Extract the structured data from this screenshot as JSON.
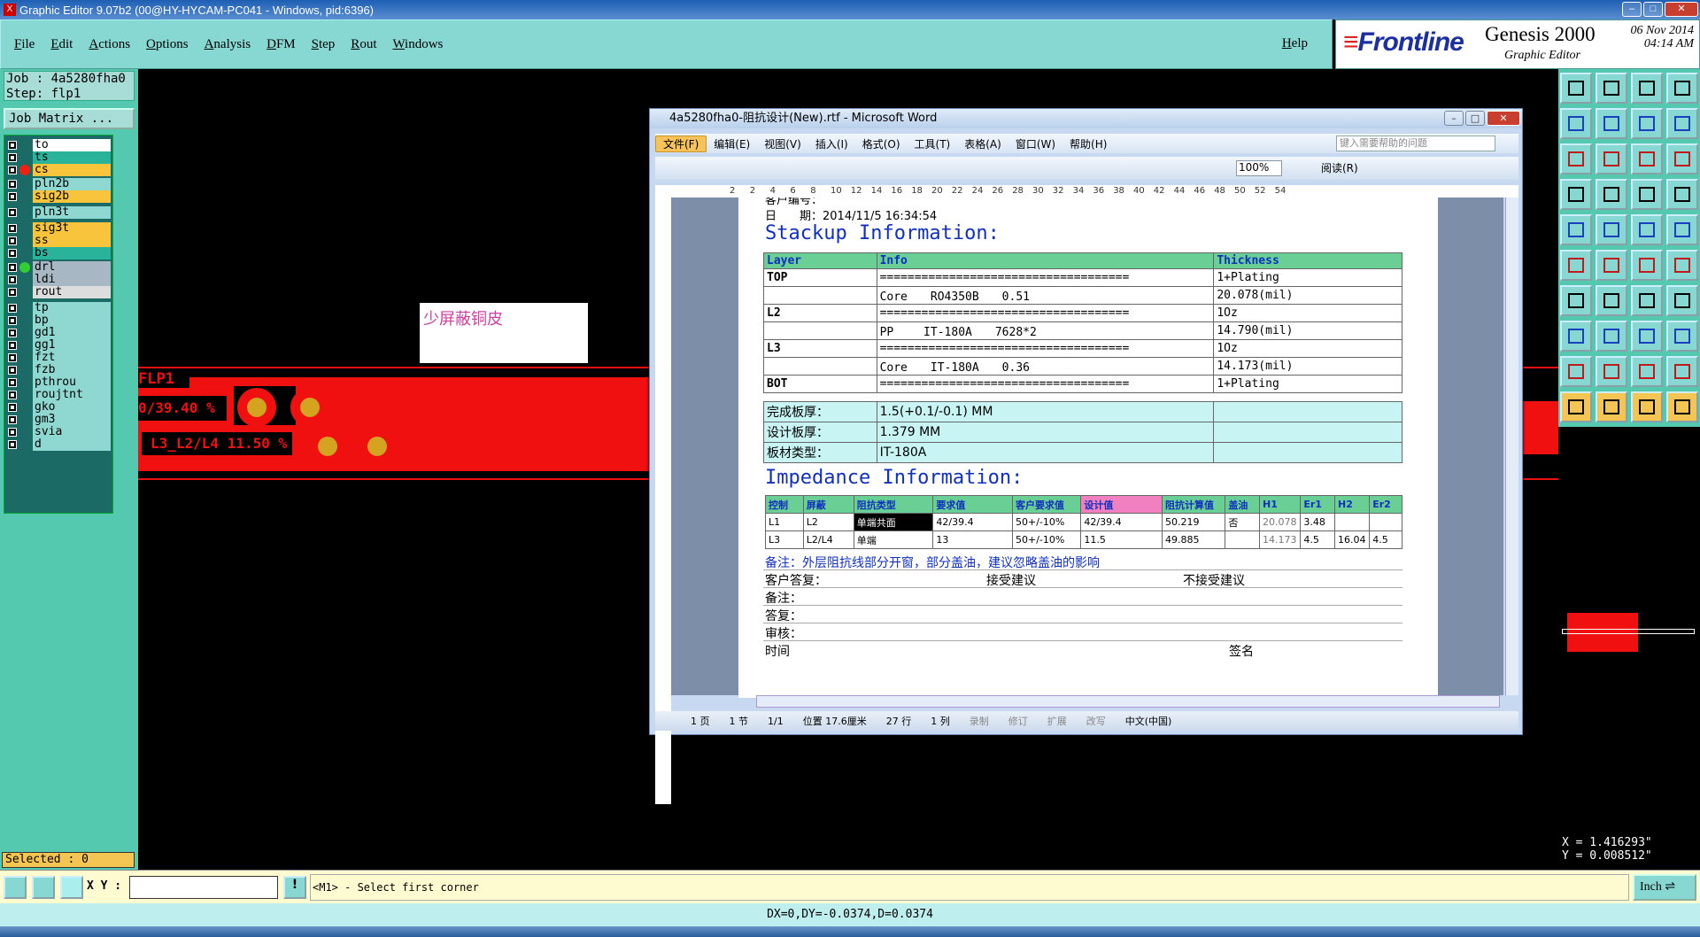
{
  "window": {
    "title": "Graphic Editor 9.07b2 (00@HY-HYCAM-PC041 - Windows, pid:6396)"
  },
  "menu": [
    "File",
    "Edit",
    "Actions",
    "Options",
    "Analysis",
    "DFM",
    "Step",
    "Rout",
    "Windows"
  ],
  "help_label": "Help",
  "brand": {
    "logo": "Frontline",
    "product": "Genesis 2000",
    "subtitle": "Graphic Editor",
    "date": "06 Nov 2014",
    "time": "04:14 AM"
  },
  "job": {
    "job_label": "Job : 4a5280fha0",
    "step_label": "Step: flp1",
    "matrix_button": "Job Matrix ..."
  },
  "layers": [
    {
      "name": "to",
      "color": "#ffffff"
    },
    {
      "name": "ts",
      "color": "#29b39b"
    },
    {
      "name": "cs",
      "color": "#f8c43c",
      "active": true
    },
    {
      "name": "pln2b",
      "color": "#8fd8d2"
    },
    {
      "name": "sig2b",
      "color": "#f8c43c"
    },
    {
      "name": "pln3t",
      "color": "#8fd8d2"
    },
    {
      "name": "sig3t",
      "color": "#f8c43c"
    },
    {
      "name": "ss",
      "color": "#f8c43c"
    },
    {
      "name": "bs",
      "color": "#29b39b"
    },
    {
      "name": "drl",
      "color": "#a7b8c4"
    },
    {
      "name": "ldi",
      "color": "#a7b8c4"
    },
    {
      "name": "rout",
      "color": "#dddddd"
    },
    {
      "name": "tp",
      "color": "#8fd8d2"
    },
    {
      "name": "bp",
      "color": "#8fd8d2"
    },
    {
      "name": "gd1",
      "color": "#8fd8d2"
    },
    {
      "name": "gg1",
      "color": "#8fd8d2"
    },
    {
      "name": "fzt",
      "color": "#8fd8d2"
    },
    {
      "name": "fzb",
      "color": "#8fd8d2"
    },
    {
      "name": "pthrou",
      "color": "#8fd8d2"
    },
    {
      "name": "roujtnt",
      "color": "#8fd8d2"
    },
    {
      "name": "gko",
      "color": "#8fd8d2"
    },
    {
      "name": "gm3",
      "color": "#8fd8d2"
    },
    {
      "name": "svia",
      "color": "#8fd8d2"
    },
    {
      "name": "d",
      "color": "#8fd8d2"
    }
  ],
  "selected_label": "Selected : 0",
  "canvas": {
    "note": "少屏蔽铜皮",
    "text1": "FLP1",
    "text2": "0/39.40 %",
    "text3": "L3_L2/L4 11.50 %"
  },
  "coords": {
    "x": "X = 1.416293\"",
    "y": "Y = 0.008512\""
  },
  "bottom": {
    "xy_label": "X Y :",
    "prompt": "<M1> - Select first corner",
    "units": "Inch"
  },
  "status_line": "DX=0,DY=-0.0374,D=0.0374",
  "word": {
    "title": "4a5280fha0-阻抗设计(New).rtf - Microsoft Word",
    "menu": [
      "文件(F)",
      "编辑(E)",
      "视图(V)",
      "插入(I)",
      "格式(O)",
      "工具(T)",
      "表格(A)",
      "窗口(W)",
      "帮助(H)"
    ],
    "search_placeholder": "键入需要帮助的问题",
    "zoom": "100%",
    "read_mode": "阅读(R)",
    "ruler": [
      "2",
      "2",
      "4",
      "6",
      "8",
      "10",
      "12",
      "14",
      "16",
      "18",
      "20",
      "22",
      "24",
      "26",
      "28",
      "30",
      "32",
      "34",
      "36",
      "38",
      "40",
      "42",
      "44",
      "46",
      "48",
      "50",
      "52",
      "54"
    ],
    "doc": {
      "line_customer": "客户编号：",
      "line_date": "日　　期：2014/11/5 16:34:54",
      "stackup_title": "Stackup Information:",
      "stackup_headers": [
        "Layer",
        "Info",
        "Thickness"
      ],
      "stackup_rows": [
        [
          "TOP",
          "====================================",
          "1+Plating"
        ],
        [
          "",
          "Core　　RO4350B　　0.51",
          "20.078(mil)"
        ],
        [
          "L2",
          "====================================",
          "1Oz"
        ],
        [
          "",
          "PP　　 IT-180A　　7628*2",
          "14.790(mil)"
        ],
        [
          "L3",
          "====================================",
          "1Oz"
        ],
        [
          "",
          "Core　　IT-180A　　0.36",
          "14.173(mil)"
        ],
        [
          "BOT",
          "====================================",
          "1+Plating"
        ]
      ],
      "board_rows": [
        [
          "完成板厚：",
          "1.5(+0.1/-0.1) MM",
          ""
        ],
        [
          "设计板厚：",
          "1.379 MM",
          ""
        ],
        [
          "板材类型：",
          "IT-180A",
          ""
        ]
      ],
      "impedance_title": "Impedance Information:",
      "imp_headers": [
        "控制",
        "屏蔽",
        "阻抗类型",
        "要求值",
        "客户要求值",
        "设计值",
        "阻抗计算值",
        "盖油",
        "H1",
        "Er1",
        "H2",
        "Er2"
      ],
      "imp_rows": [
        [
          "L1",
          "L2",
          "单端共面",
          "42/39.4",
          "50+/-10%",
          "42/39.4",
          "50.219",
          "否",
          "20.078",
          "3.48",
          "",
          ""
        ],
        [
          "L3",
          "L2/L4",
          "单端",
          "13",
          "50+/-10%",
          "11.5",
          "49.885",
          "",
          "14.173",
          "4.5",
          "16.04",
          "4.5"
        ]
      ],
      "remark": "备注：外层阻抗线部分开窗，部分盖油，建议忽略盖油的影响",
      "reply": "客户答复：",
      "accept": "接受建议",
      "reject": "不接受建议",
      "remark2": "备注：",
      "answer": "答复：",
      "review": "审核：",
      "time": "时间",
      "sign": "签名"
    },
    "status": [
      "1 页",
      "1 节",
      "1/1",
      "位置 17.6厘米",
      "27 行",
      "1 列",
      "录制",
      "修订",
      "扩展",
      "改写",
      "中文(中国)"
    ]
  }
}
